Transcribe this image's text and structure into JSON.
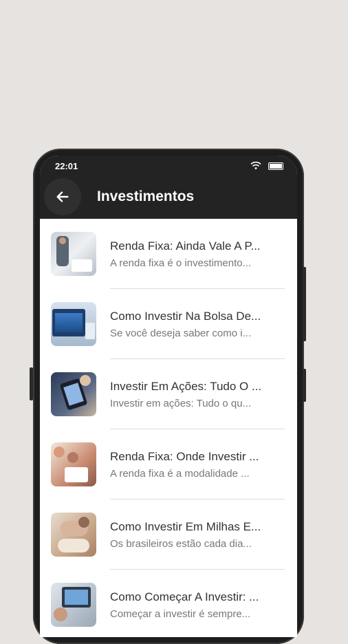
{
  "status_bar": {
    "time": "22:01",
    "wifi_icon": "wifi-icon",
    "battery_icon": "battery-icon"
  },
  "app_bar": {
    "title": "Investimentos",
    "back_icon": "arrow-left-icon"
  },
  "articles": [
    {
      "title": "Renda Fixa: Ainda Vale A P...",
      "subtitle": "A renda fixa é o investimento..."
    },
    {
      "title": "Como Investir Na Bolsa De...",
      "subtitle": "Se você deseja saber como i..."
    },
    {
      "title": "Investir Em Ações: Tudo O ...",
      "subtitle": "Investir em ações: Tudo o qu..."
    },
    {
      "title": "Renda Fixa: Onde Investir ...",
      "subtitle": "A renda fixa é a modalidade ..."
    },
    {
      "title": "Como Investir Em Milhas E...",
      "subtitle": "Os brasileiros estão cada dia..."
    },
    {
      "title": "Como Começar A Investir: ...",
      "subtitle": "Começar a investir é sempre..."
    }
  ]
}
